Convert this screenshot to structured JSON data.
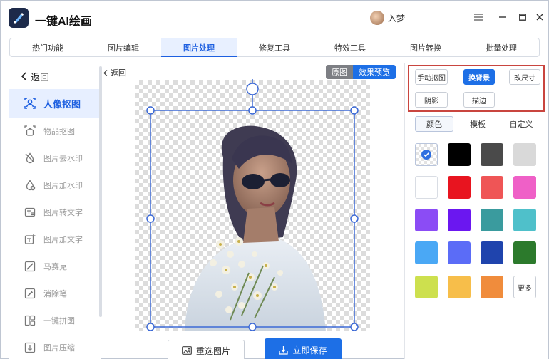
{
  "window": {
    "app_title": "一键AI绘画",
    "user_name": "入梦"
  },
  "tabs": [
    {
      "label": "热门功能",
      "active": false
    },
    {
      "label": "图片编辑",
      "active": false
    },
    {
      "label": "图片处理",
      "active": true
    },
    {
      "label": "修复工具",
      "active": false
    },
    {
      "label": "特效工具",
      "active": false
    },
    {
      "label": "图片转换",
      "active": false
    },
    {
      "label": "批量处理",
      "active": false
    }
  ],
  "sidebar": {
    "back_label": "返回",
    "items": [
      {
        "label": "人像抠图",
        "icon": "portrait-cutout-icon",
        "active": true
      },
      {
        "label": "物品抠图",
        "icon": "object-cutout-icon"
      },
      {
        "label": "图片去水印",
        "icon": "remove-watermark-icon"
      },
      {
        "label": "图片加水印",
        "icon": "add-watermark-icon"
      },
      {
        "label": "图片转文字",
        "icon": "image-to-text-icon"
      },
      {
        "label": "图片加文字",
        "icon": "add-text-icon"
      },
      {
        "label": "马赛克",
        "icon": "mosaic-icon"
      },
      {
        "label": "消除笔",
        "icon": "eraser-pen-icon"
      },
      {
        "label": "一键拼图",
        "icon": "collage-icon"
      },
      {
        "label": "图片压缩",
        "icon": "compress-icon"
      }
    ]
  },
  "canvas": {
    "back_label": "返回",
    "toggle_original": "原图",
    "toggle_preview": "效果预览",
    "reselect_label": "重选图片",
    "save_label": "立即保存"
  },
  "right_panel": {
    "options": [
      "手动抠图",
      "换背景",
      "改尺寸",
      "阴影",
      "描边"
    ],
    "active_option": "换背景",
    "subtabs": [
      "颜色",
      "模板",
      "自定义"
    ],
    "active_subtab": "颜色",
    "colors": [
      "transparent",
      "#000000",
      "#4a4a4a",
      "#d9d9d9",
      "#ffffff",
      "#e8141f",
      "#ef5556",
      "#ef60c7",
      "#8b4cf5",
      "#6b17f0",
      "#3a9b9e",
      "#4fc0ca",
      "#4aa8f5",
      "#5b6cf7",
      "#1f44ad",
      "#2c7a2c",
      "#cde04e",
      "#f7be4a",
      "#f08c3c"
    ],
    "more_label": "更多",
    "accent": "#1d6fe6",
    "highlight_color": "#c9453f"
  }
}
